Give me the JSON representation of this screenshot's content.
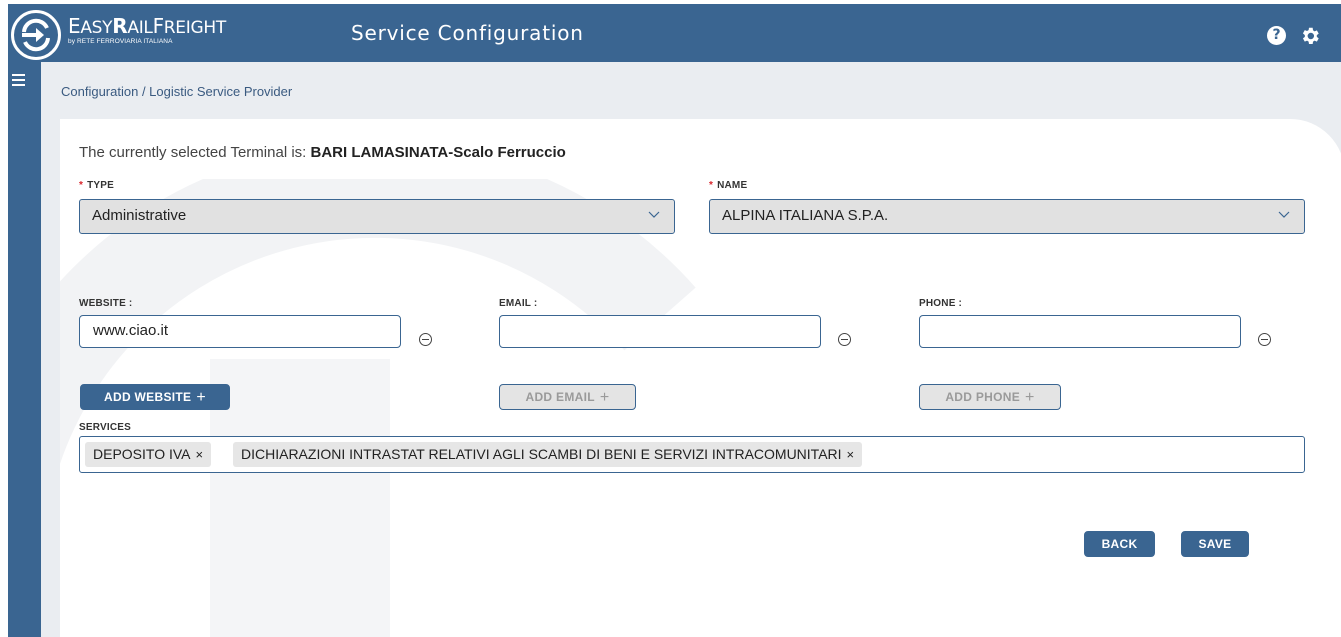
{
  "header": {
    "logo": {
      "main": "EasyRailFreight",
      "sub": "by RETE FERROVIARIA ITALIANA"
    },
    "title": "Service Configuration",
    "help_icon": "help-circle-icon",
    "settings_icon": "gear-icon"
  },
  "sidebar": {
    "menu_icon": "hamburger-menu-icon"
  },
  "breadcrumb": "Configuration / Logistic Service Provider",
  "terminal": {
    "prefix": "The currently selected Terminal is:",
    "name": "BARI LAMASINATA-Scalo Ferruccio"
  },
  "form": {
    "type": {
      "label": "TYPE",
      "required_mark": "*",
      "value": "Administrative"
    },
    "name": {
      "label": "NAME",
      "required_mark": "*",
      "value": "ALPINA ITALIANA S.P.A."
    },
    "website": {
      "label": "WEBSITE :",
      "value": "www.ciao.it",
      "add_label": "ADD WEBSITE"
    },
    "email": {
      "label": "EMAIL :",
      "value": "",
      "add_label": "ADD EMAIL"
    },
    "phone": {
      "label": "PHONE :",
      "value": "",
      "add_label": "ADD PHONE"
    },
    "services": {
      "label": "SERVICES",
      "tags": [
        "DEPOSITO IVA",
        "DICHIARAZIONI INTRASTAT RELATIVI AGLI SCAMBI DI BENI E SERVIZI INTRACOMUNITARI"
      ],
      "remove_glyph": "×"
    }
  },
  "actions": {
    "back": "BACK",
    "save": "SAVE"
  },
  "colors": {
    "primary": "#3a6591",
    "background": "#eaedf1",
    "required": "#d9262c"
  }
}
